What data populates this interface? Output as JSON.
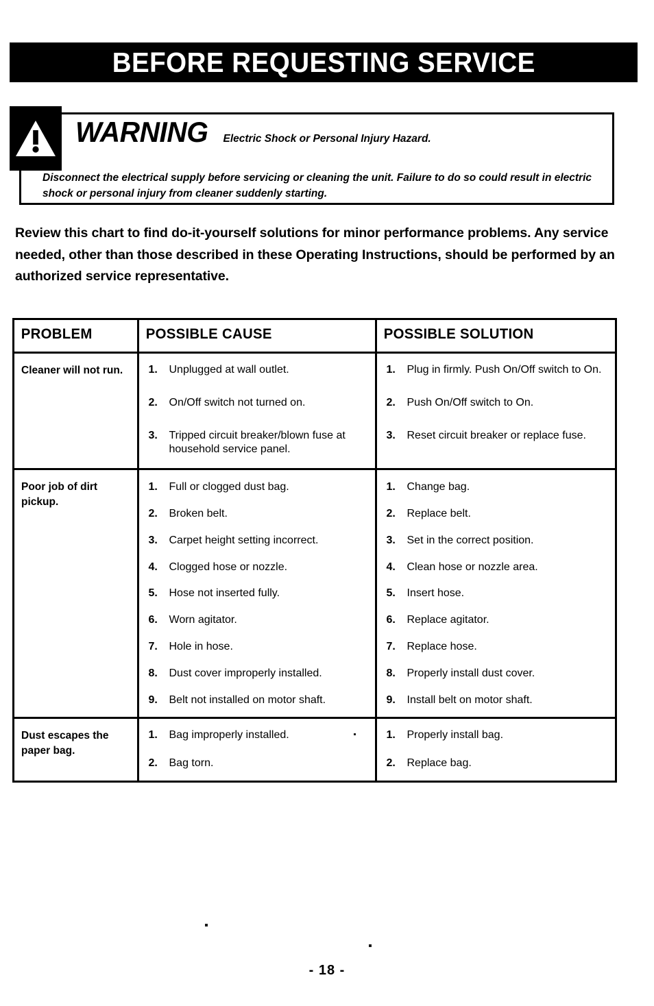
{
  "page": {
    "heading": "BEFORE REQUESTING SERVICE",
    "footer": "- 18 -"
  },
  "warning": {
    "icon": "warning-triangle-exclamation-icon",
    "word": "WARNING",
    "hazard": "Electric Shock or Personal Injury Hazard.",
    "body": "Disconnect the electrical supply before servicing or cleaning the unit.  Failure to do so could result in electric shock or personal injury from cleaner suddenly starting."
  },
  "intro": "Review this chart to find do-it-yourself solutions for minor performance problems.  Any service needed, other than those described in these Operating Instructions, should be performed by an authorized service representative.",
  "table": {
    "headers": {
      "problem": "PROBLEM",
      "cause": "POSSIBLE CAUSE",
      "solution": "POSSIBLE SOLUTION"
    },
    "rows": [
      {
        "problem": "Cleaner will not run.",
        "causes": [
          "Unplugged at wall outlet.",
          "On/Off switch not turned on.",
          "Tripped circuit breaker/blown fuse at household service panel."
        ],
        "solutions": [
          "Plug in firmly.  Push On/Off switch to On.",
          "Push On/Off switch to On.",
          "Reset circuit breaker or replace fuse."
        ]
      },
      {
        "problem": "Poor job of dirt pickup.",
        "causes": [
          "Full or clogged dust bag.",
          "Broken belt.",
          "Carpet height setting incorrect.",
          "Clogged hose or nozzle.",
          "Hose not inserted fully.",
          "Worn agitator.",
          "Hole in hose.",
          "Dust cover improperly installed.",
          "Belt not installed on motor shaft."
        ],
        "solutions": [
          "Change bag.",
          "Replace belt.",
          "Set in the correct position.",
          "Clean hose or nozzle area.",
          "Insert hose.",
          "Replace agitator.",
          "Replace hose.",
          "Properly install dust cover.",
          "Install belt on motor shaft."
        ]
      },
      {
        "problem": "Dust escapes the paper bag.",
        "causes": [
          "Bag improperly installed.",
          "Bag torn."
        ],
        "solutions": [
          "Properly install bag.",
          "Replace bag."
        ]
      }
    ]
  }
}
